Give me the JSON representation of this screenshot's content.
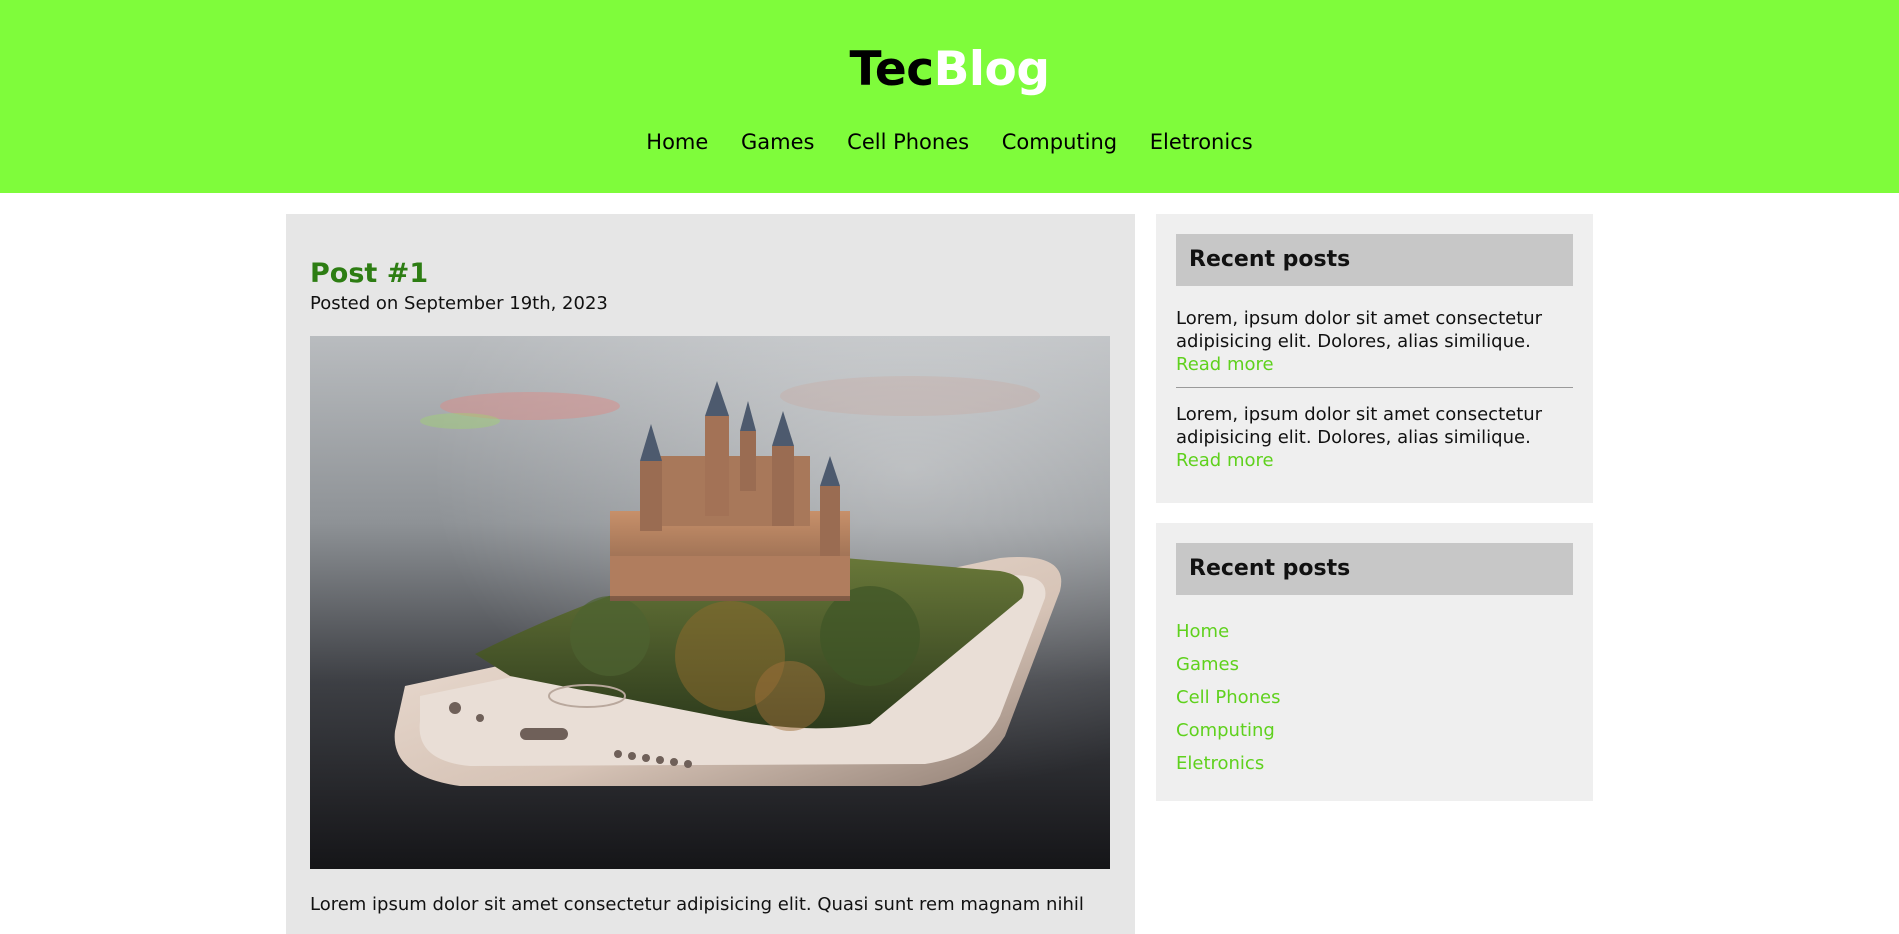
{
  "header": {
    "brand_part1": "Tec",
    "brand_part2": "Blog",
    "nav": [
      "Home",
      "Games",
      "Cell Phones",
      "Computing",
      "Eletronics"
    ]
  },
  "post": {
    "title": "Post #1",
    "date": "Posted on September 19th, 2023",
    "image_alt": "castle-on-smartphone-image",
    "text": "Lorem ipsum dolor sit amet consectetur adipisicing elit. Quasi sunt rem magnam nihil"
  },
  "sidebar": {
    "recent": {
      "title": "Recent posts",
      "items": [
        {
          "text": "Lorem, ipsum dolor sit amet consectetur adipisicing elit. Dolores, alias similique.",
          "link": "Read more"
        },
        {
          "text": "Lorem, ipsum dolor sit amet consectetur adipisicing elit. Dolores, alias similique.",
          "link": "Read more"
        }
      ]
    },
    "categories": {
      "title": "Recent posts",
      "links": [
        "Home",
        "Games",
        "Cell Phones",
        "Computing",
        "Eletronics"
      ]
    }
  },
  "colors": {
    "header_bg": "#7ffc3b",
    "accent_link": "#5fd11d",
    "post_title": "#2d7d13"
  }
}
